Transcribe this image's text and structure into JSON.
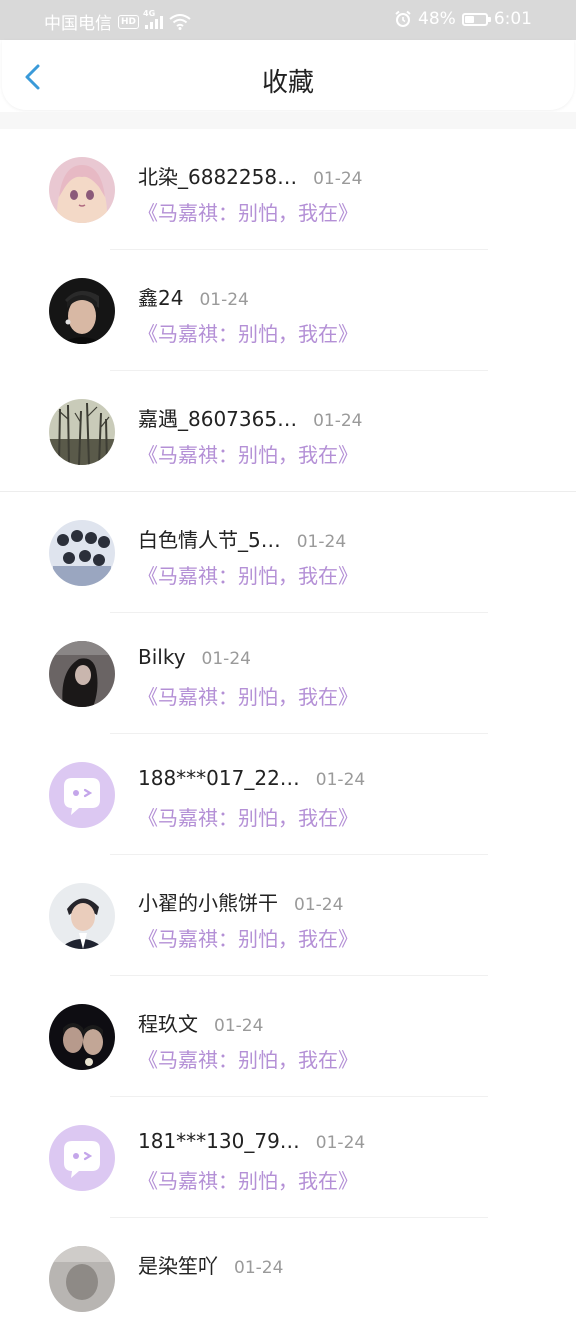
{
  "status_bar": {
    "carrier": "中国电信",
    "hd": "HD",
    "network": "4G",
    "battery": "48%",
    "time": "6:01"
  },
  "header": {
    "title": "收藏",
    "back_icon": "chevron-left-icon",
    "back_color": "#3a9ad9"
  },
  "colors": {
    "title_link": "#b490d6",
    "default_avatar_bg": "#dcc8f2"
  },
  "favorites": [
    {
      "username": "北染_6882258…",
      "date": "01-24",
      "title": "《马嘉祺：别怕，我在》",
      "avatar": "anime-girl-avatar"
    },
    {
      "username": "鑫24",
      "date": "01-24",
      "title": "《马嘉祺：别怕，我在》",
      "avatar": "photo-avatar"
    },
    {
      "username": "嘉遇_8607365…",
      "date": "01-24",
      "title": "《马嘉祺：别怕，我在》",
      "avatar": "trees-avatar"
    },
    {
      "username": "白色情人节_5…",
      "date": "01-24",
      "title": "《马嘉祺：别怕，我在》",
      "avatar": "group-avatar"
    },
    {
      "username": "Bilky",
      "date": "01-24",
      "title": "《马嘉祺：别怕，我在》",
      "avatar": "photo-avatar"
    },
    {
      "username": "188***017_22…",
      "date": "01-24",
      "title": "《马嘉祺：别怕，我在》",
      "avatar": "default-chat-avatar"
    },
    {
      "username": "小翟的小熊饼干",
      "date": "01-24",
      "title": "《马嘉祺：别怕，我在》",
      "avatar": "photo-avatar"
    },
    {
      "username": "程玖文",
      "date": "01-24",
      "title": "《马嘉祺：别怕，我在》",
      "avatar": "photo-avatar"
    },
    {
      "username": "181***130_79…",
      "date": "01-24",
      "title": "《马嘉祺：别怕，我在》",
      "avatar": "default-chat-avatar"
    },
    {
      "username": "是染笙吖",
      "date": "01-24",
      "title": "",
      "avatar": "photo-avatar"
    }
  ]
}
